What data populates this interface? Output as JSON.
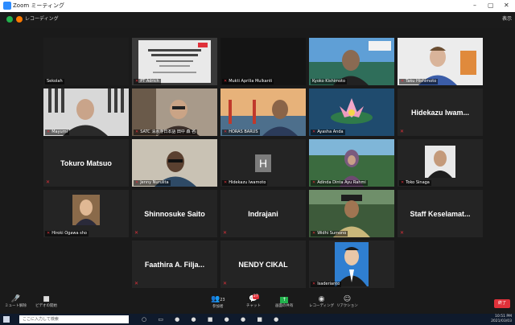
{
  "window": {
    "title": "Zoom ミーティング",
    "minimize": "–",
    "maximize": "▢",
    "close": "✕"
  },
  "topbar": {
    "recording_label": "レコーディング",
    "view_label": "表示"
  },
  "tiles": [
    {
      "name": "Sekolah",
      "bigname": "",
      "muted": false
    },
    {
      "name": "PT Adrich",
      "bigname": "",
      "muted": true
    },
    {
      "name": "Mukti Aprilia Mulkanti",
      "bigname": "",
      "muted": true
    },
    {
      "name": "Kyoko Kishimoto",
      "bigname": "",
      "muted": false
    },
    {
      "name": "Taku Hishimoto",
      "bigname": "",
      "muted": true
    },
    {
      "name": "Mayumi",
      "bigname": "",
      "muted": true
    },
    {
      "name": "SATC 清水寺日本語 田中 森 名",
      "bigname": "",
      "muted": true
    },
    {
      "name": "HORAS BARUS",
      "bigname": "",
      "muted": true
    },
    {
      "name": "Ayasha Anda",
      "bigname": "",
      "muted": true
    },
    {
      "name": "",
      "bigname": "Hidekazu Iwam...",
      "muted": true
    },
    {
      "name": "",
      "bigname": "Tokuro Matsuo",
      "muted": true
    },
    {
      "name": "Jenny Nurulita",
      "bigname": "",
      "muted": true
    },
    {
      "name": "Hidekazu Iwamoto",
      "bigname": "",
      "muted": true,
      "initial": "H"
    },
    {
      "name": "Adinda Dinta Ayu Rahmi",
      "bigname": "",
      "muted": true
    },
    {
      "name": "Toko Sinaga",
      "bigname": "",
      "muted": true
    },
    {
      "name": "Hiroki Ogawa sho",
      "bigname": "",
      "muted": true
    },
    {
      "name": "",
      "bigname": "Shinnosuke Saito",
      "muted": true
    },
    {
      "name": "",
      "bigname": "Indrajani",
      "muted": true
    },
    {
      "name": "Widhi Sumono",
      "bigname": "",
      "muted": true
    },
    {
      "name": "",
      "bigname": "Staff Keselamat...",
      "muted": true
    },
    {
      "name": "",
      "bigname": "Faathira A. Filja...",
      "muted": true
    },
    {
      "name": "",
      "bigname": "NENDY CIKAL",
      "muted": true
    },
    {
      "name": "Isaderianto",
      "bigname": "",
      "muted": true
    }
  ],
  "toolbar": {
    "mute_label": "ミュート解除",
    "video_label": "ビデオの開始",
    "participants_label": "参加者",
    "participants_count": "23",
    "chat_label": "チャット",
    "chat_badge": "27",
    "share_label": "画面の共有",
    "record_label": "レコーディング",
    "reaction_label": "リアクション",
    "end_label": "終了"
  },
  "taskbar": {
    "search_placeholder": "ここに入力して検索",
    "time": "10:51 PM",
    "date": "2021/03/03"
  },
  "colors": {
    "mute_red": "#e0313a",
    "active_speaker": "#9ad43a",
    "share_green": "#22b14c"
  }
}
